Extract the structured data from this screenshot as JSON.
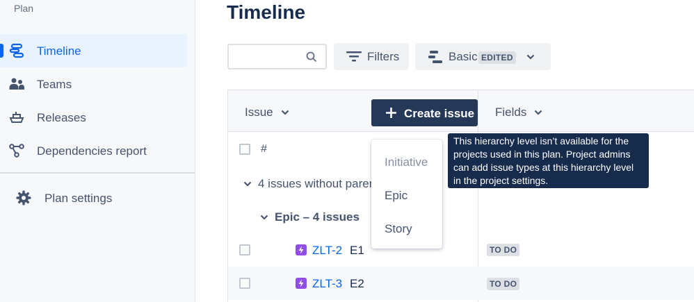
{
  "sidebar": {
    "section_label": "Plan",
    "items": [
      {
        "label": "Timeline",
        "icon": "timeline-icon"
      },
      {
        "label": "Teams",
        "icon": "teams-icon"
      },
      {
        "label": "Releases",
        "icon": "releases-icon"
      },
      {
        "label": "Dependencies report",
        "icon": "dependencies-icon"
      }
    ],
    "settings_label": "Plan settings"
  },
  "main": {
    "title": "Timeline",
    "search": {
      "value": "",
      "placeholder": ""
    },
    "filters_label": "Filters",
    "view": {
      "label": "Basic",
      "badge": "EDITED"
    }
  },
  "table": {
    "issue_header": "Issue",
    "fields_header": "Fields",
    "number_header": "#",
    "group_label": "4 issues without parent",
    "epic_group_label": "Epic – 4 issues",
    "rows": [
      {
        "key": "ZLT-2",
        "summary": "E1",
        "status": "TO DO"
      },
      {
        "key": "ZLT-3",
        "summary": "E2",
        "status": "TO DO"
      }
    ]
  },
  "create_issue": {
    "label": "Create issue",
    "menu": [
      {
        "label": "Initiative",
        "disabled": true
      },
      {
        "label": "Epic",
        "disabled": false
      },
      {
        "label": "Story",
        "disabled": false
      }
    ]
  },
  "tooltip": {
    "text": "This hierarchy level isn’t available for the projects used in this plan. Project admins can add issue types at this hierarchy level in the project settings."
  },
  "colors": {
    "accent": "#0c66e4",
    "create_button": "#253858",
    "tooltip_bg": "#172b4d",
    "epic_icon": "#904ee2"
  }
}
